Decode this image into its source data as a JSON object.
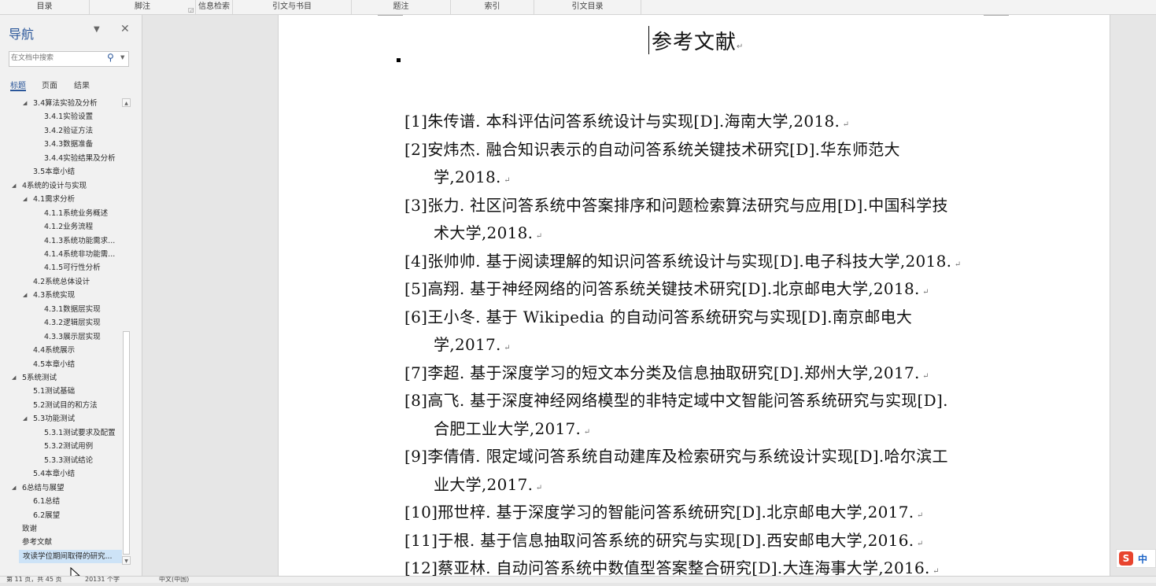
{
  "ribbon": {
    "groups": [
      "目录",
      "脚注",
      "信息检索",
      "引文与书目",
      "题注",
      "索引",
      "引文目录"
    ]
  },
  "nav": {
    "title": "导航",
    "options_icon": "chevron-down-icon",
    "close_icon": "close-icon",
    "search_placeholder": "在文档中搜索",
    "search_icon": "magnifier-icon",
    "tabs": [
      "标题",
      "页面",
      "结果"
    ],
    "tree": [
      {
        "label": "3.4算法实验及分析",
        "level": 2,
        "expanded": true
      },
      {
        "label": "3.4.1实验设置",
        "level": 3
      },
      {
        "label": "3.4.2验证方法",
        "level": 3
      },
      {
        "label": "3.4.3数据准备",
        "level": 3
      },
      {
        "label": "3.4.4实验结果及分析",
        "level": 3
      },
      {
        "label": "3.5本章小结",
        "level": 2
      },
      {
        "label": "4系统的设计与实现",
        "level": 1,
        "expanded": true
      },
      {
        "label": "4.1需求分析",
        "level": 2,
        "expanded": true
      },
      {
        "label": "4.1.1系统业务概述",
        "level": 3
      },
      {
        "label": "4.1.2业务流程",
        "level": 3
      },
      {
        "label": "4.1.3系统功能需求...",
        "level": 3
      },
      {
        "label": "4.1.4系统非功能需...",
        "level": 3
      },
      {
        "label": "4.1.5可行性分析",
        "level": 3
      },
      {
        "label": "4.2系统总体设计",
        "level": 2
      },
      {
        "label": "4.3系统实现",
        "level": 2,
        "expanded": true
      },
      {
        "label": "4.3.1数据层实现",
        "level": 3
      },
      {
        "label": "4.3.2逻辑层实现",
        "level": 3
      },
      {
        "label": "4.3.3展示层实现",
        "level": 3
      },
      {
        "label": "4.4系统展示",
        "level": 2
      },
      {
        "label": "4.5本章小结",
        "level": 2
      },
      {
        "label": "5系统测试",
        "level": 1,
        "expanded": true
      },
      {
        "label": "5.1测试基础",
        "level": 2
      },
      {
        "label": "5.2测试目的和方法",
        "level": 2
      },
      {
        "label": "5.3功能测试",
        "level": 2,
        "expanded": true
      },
      {
        "label": "5.3.1测试要求及配置",
        "level": 3
      },
      {
        "label": "5.3.2测试用例",
        "level": 3
      },
      {
        "label": "5.3.3测试结论",
        "level": 3
      },
      {
        "label": "5.4本章小结",
        "level": 2
      },
      {
        "label": "6总结与展望",
        "level": 1,
        "expanded": true
      },
      {
        "label": "6.1总结",
        "level": 2
      },
      {
        "label": "6.2展望",
        "level": 2
      },
      {
        "label": "致谢",
        "level": 1
      },
      {
        "label": "参考文献",
        "level": 1
      },
      {
        "label": "攻读学位期间取得的研究...",
        "level": 1,
        "selected": true
      }
    ]
  },
  "document": {
    "heading": "参考文献",
    "references": [
      {
        "lines": [
          "[1]朱传谱. 本科评估问答系统设计与实现[D].海南大学,2018."
        ]
      },
      {
        "lines": [
          "[2]安炜杰. 融合知识表示的自动问答系统关键技术研究[D].华东师范大",
          "学,2018."
        ]
      },
      {
        "lines": [
          "[3]张力. 社区问答系统中答案排序和问题检索算法研究与应用[D].中国科学技",
          "术大学,2018."
        ]
      },
      {
        "lines": [
          "[4]张帅帅. 基于阅读理解的知识问答系统设计与实现[D].电子科技大学,2018."
        ]
      },
      {
        "lines": [
          "[5]高翔. 基于神经网络的问答系统关键技术研究[D].北京邮电大学,2018."
        ]
      },
      {
        "lines": [
          "[6]王小冬. 基于 Wikipedia 的自动问答系统研究与实现[D].南京邮电大",
          "学,2017."
        ]
      },
      {
        "lines": [
          "[7]李超. 基于深度学习的短文本分类及信息抽取研究[D].郑州大学,2017."
        ]
      },
      {
        "lines": [
          "[8]高飞. 基于深度神经网络模型的非特定域中文智能问答系统研究与实现[D].",
          "合肥工业大学,2017."
        ]
      },
      {
        "lines": [
          "[9]李倩倩. 限定域问答系统自动建库及检索研究与系统设计实现[D].哈尔滨工",
          "业大学,2017."
        ]
      },
      {
        "lines": [
          "[10]邢世梓. 基于深度学习的智能问答系统研究[D].北京邮电大学,2017."
        ]
      },
      {
        "lines": [
          "[11]于根. 基于信息抽取问答系统的研究与实现[D].西安邮电大学,2016."
        ]
      },
      {
        "lines": [
          "[12]蔡亚林. 自动问答系统中数值型答案整合研究[D].大连海事大学,2016."
        ]
      }
    ]
  },
  "status": {
    "page": "第 11 页，共 45 页",
    "words": "20131 个字",
    "language": "中文(中国)"
  },
  "ime": {
    "logo": "S",
    "mode": "中"
  }
}
